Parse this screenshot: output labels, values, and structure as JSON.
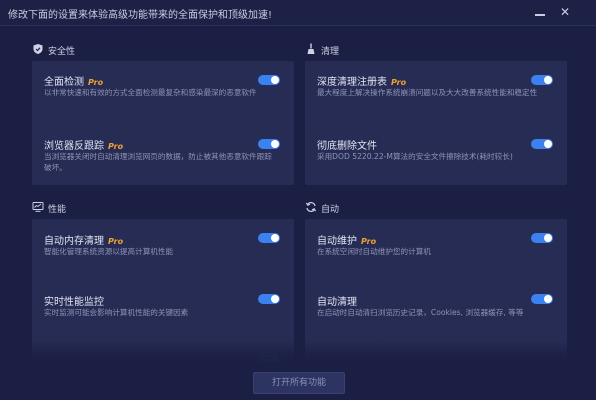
{
  "window": {
    "title": "修改下面的设置来体验高级功能带来的全面保护和顶级加速!",
    "minimize_label": "",
    "close_label": "✕"
  },
  "sections": {
    "security": {
      "label": "安全性",
      "icon": "shield-icon"
    },
    "cleanup": {
      "label": "清理",
      "icon": "broom-icon"
    },
    "performance": {
      "label": "性能",
      "icon": "monitor-icon"
    },
    "auto": {
      "label": "自动",
      "icon": "refresh-icon"
    }
  },
  "items": {
    "full_scan": {
      "title": "全面检测",
      "badge": "Pro",
      "desc": "以非常快速和有效的方式全面检测最复杂和感染最深的恶意软件",
      "enabled": true
    },
    "browser_anti_tracking": {
      "title": "浏览器反跟踪",
      "badge": "Pro",
      "desc": "当浏览器关闭时自动清理浏览网页的数据，防止被其他恶意软件跟踪破坏。",
      "enabled": true
    },
    "deep_registry": {
      "title": "深度清理注册表",
      "badge": "Pro",
      "desc": "最大程度上解决操作系统崩溃问题以及大大改善系统性能和稳定性",
      "enabled": true
    },
    "file_shredder": {
      "title": "彻底删除文件",
      "desc": "采用DOD 5220.22-M算法的安全文件擦除技术(耗时较长)",
      "enabled": true
    },
    "auto_ram": {
      "title": "自动内存清理",
      "badge": "Pro",
      "desc": "智能化管理系统资源以提高计算机性能",
      "enabled": true
    },
    "perf_monitor": {
      "title": "实时性能监控",
      "desc": "实时监测可能会影响计算机性能的关键因素",
      "enabled": true
    },
    "auto_maintenance": {
      "title": "自动维护",
      "badge": "Pro",
      "desc": "在系统空闲时自动维护您的计算机",
      "enabled": true
    },
    "auto_clean": {
      "title": "自动清理",
      "desc": "在启动时自动清扫浏览历史记录，Cookies, 浏览器缓存, 等等",
      "enabled": true
    }
  },
  "footer": {
    "enable_all_label": "打开所有功能"
  }
}
